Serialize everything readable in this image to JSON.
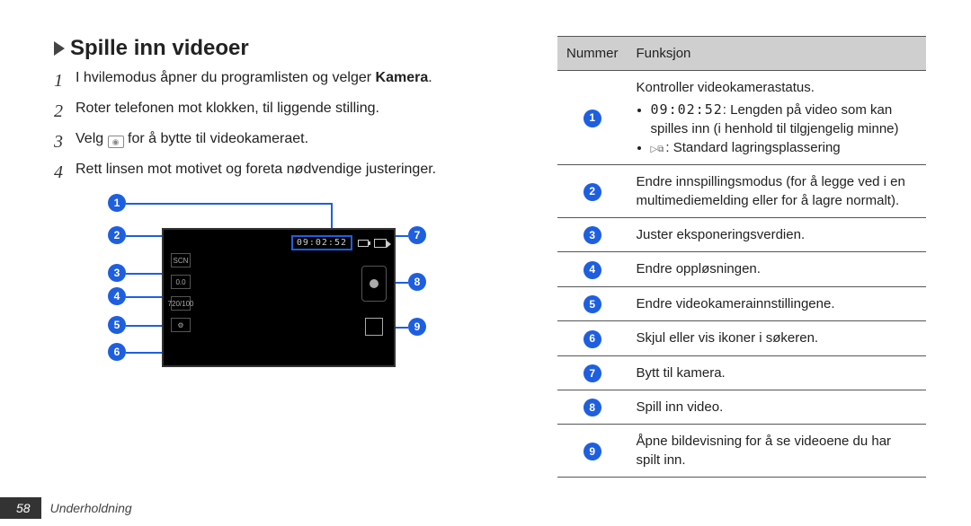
{
  "heading": "Spille inn videoer",
  "steps": {
    "s1_prefix": "I hvilemodus åpner du programlisten og velger ",
    "s1_bold": "Kamera",
    "s1_suffix": ".",
    "s2": "Roter telefonen mot klokken, til liggende stilling.",
    "s3_prefix": "Velg ",
    "s3_suffix": " for å bytte til videokameraet.",
    "s4": "Rett linsen mot motivet og foreta nødvendige justeringer."
  },
  "step_numbers": {
    "n1": "1",
    "n2": "2",
    "n3": "3",
    "n4": "4"
  },
  "diagram": {
    "time_length": "09:02:52",
    "scn_label": "SCN",
    "exposure_label": "0.0",
    "resolution_label": "720/100"
  },
  "callout_nums": {
    "c1": "1",
    "c2": "2",
    "c3": "3",
    "c4": "4",
    "c5": "5",
    "c6": "6",
    "c7": "7",
    "c8": "8",
    "c9": "9"
  },
  "table": {
    "head_num": "Nummer",
    "head_func": "Funksjon",
    "row1": {
      "intro": "Kontroller videokamerastatus.",
      "li1_prefix": "",
      "li1_time": "09:02:52",
      "li1_text": ": Lengden på video som kan spilles inn (i henhold til tilgjengelig minne)",
      "li2": ": Standard lagringsplassering"
    },
    "row2": "Endre innspillingsmodus (for å legge ved i en multimediemelding eller for å lagre normalt).",
    "row3": "Juster eksponeringsverdien.",
    "row4": "Endre oppløsningen.",
    "row5": "Endre videokamerainnstillingene.",
    "row6": "Skjul eller vis ikoner i søkeren.",
    "row7": "Bytt til kamera.",
    "row8": "Spill inn video.",
    "row9": "Åpne bildevisning for å se videoene du har spilt inn."
  },
  "footer": {
    "page": "58",
    "section": "Underholdning"
  }
}
